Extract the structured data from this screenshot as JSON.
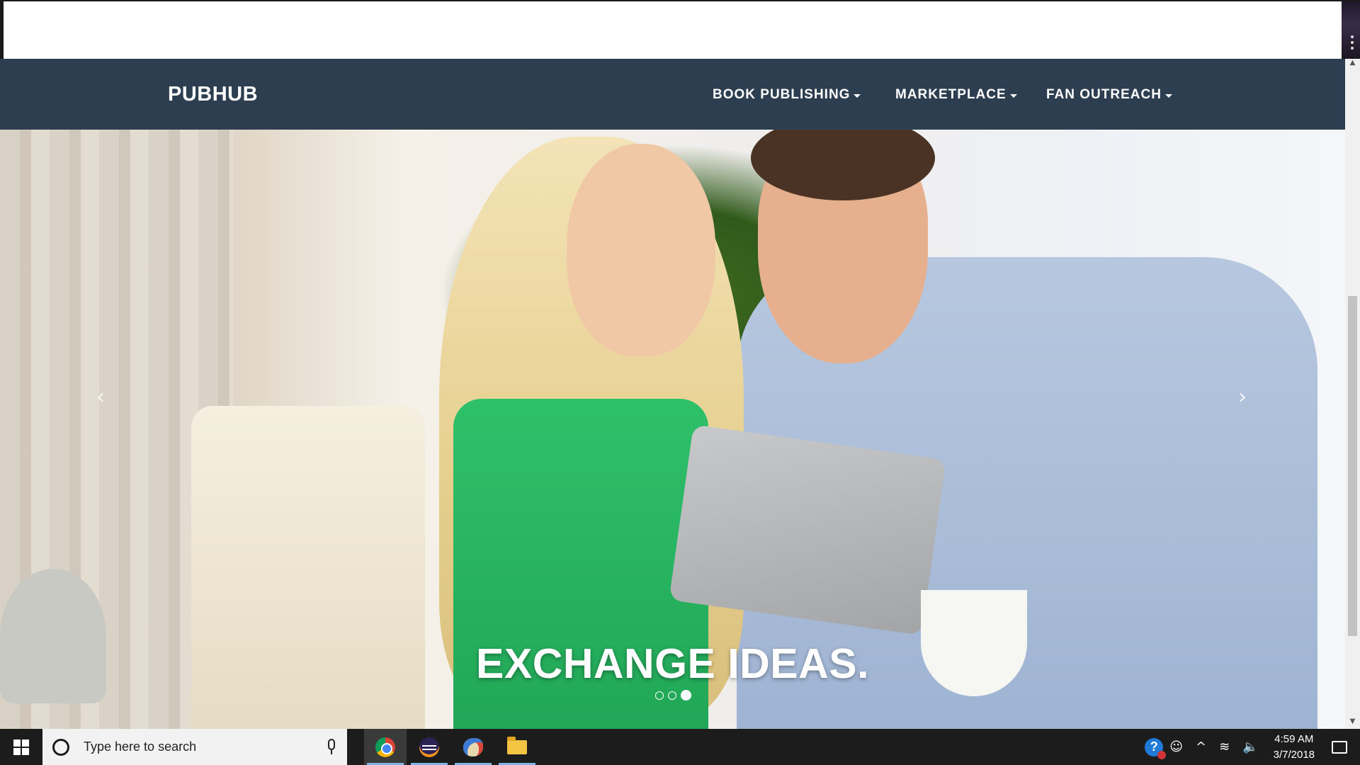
{
  "site": {
    "brand": "PUBHUB",
    "nav": [
      {
        "label": "BOOK PUBLISHING"
      },
      {
        "label": "MARKETPLACE"
      },
      {
        "label": "FAN OUTREACH"
      }
    ]
  },
  "carousel": {
    "caption": "EXCHANGE IDEAS.",
    "prev_glyph": "‹",
    "next_glyph": "›",
    "slide_count": 3,
    "active_slide": 3
  },
  "taskbar": {
    "search_placeholder": "Type here to search",
    "apps": [
      "chrome-icon",
      "eclipse-icon",
      "paint-icon",
      "file-explorer-icon"
    ],
    "time": "4:59 AM",
    "date": "3/7/2018"
  },
  "colors": {
    "navbar_bg": "#2c3e50",
    "taskbar_bg": "#1c1c1c"
  }
}
